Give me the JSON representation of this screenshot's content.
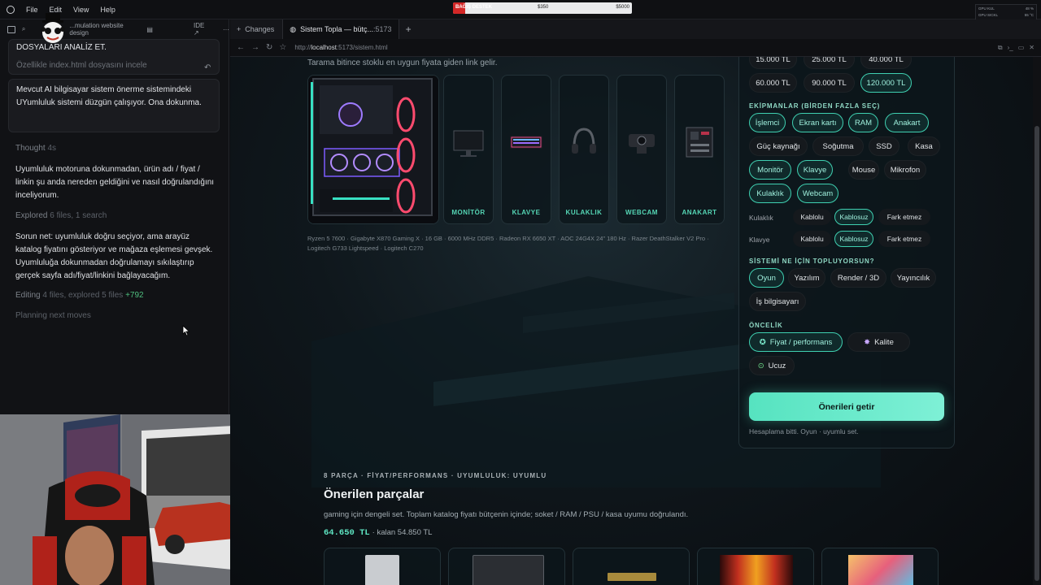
{
  "menubar": {
    "items": [
      "File",
      "Edit",
      "View",
      "Help"
    ]
  },
  "donation": {
    "label": "BAĞIŞ DESTEK",
    "current": "$350",
    "goal": "$5000",
    "progress": 0.07
  },
  "hwmon": {
    "rows": [
      {
        "label": "GPU KUL",
        "value": "48 %"
      },
      {
        "label": "GPU SICKL",
        "value": "55 °C"
      },
      {
        "label": "CPU KUL",
        "value": "28 %"
      },
      {
        "label": "CPU TEMP",
        "value": "74.5 °C"
      }
    ]
  },
  "left_panel": {
    "title": "...mulation website design",
    "ide_label": "IDE ↗",
    "prev_msg_line1": "DOSYALARI ANALİZ ET.",
    "prev_msg_line2": "Özellikle index.html dosyasını incele",
    "user_msg": "Mevcut AI bilgisayar sistem önerme sistemindeki UYumluluk sistemi düzgün çalışıyor. Ona dokunma.",
    "thought_label": "Thought",
    "thought_time": "4s",
    "para1": "Uyumluluk motoruna dokunmadan, ürün adı / fiyat / linkin şu anda nereden geldiğini ve nasıl doğrulandığını inceliyorum.",
    "explored_label": "Explored",
    "explored_detail": "6 files, 1 search",
    "para2": "Sorun net: uyumluluk doğru seçiyor, ama arayüz katalog fiyatını gösteriyor ve mağaza eşlemesi gevşek. Uyumluluğa dokunmadan doğrulamayı sıkılaştırıp gerçek sayfa adı/fiyat/linkini bağlayacağım.",
    "editing_label": "Editing",
    "editing_detail": "4 files, explored 5 files",
    "editing_added": "+792",
    "planning": "Planning next moves"
  },
  "browser": {
    "changes_tab": "Changes",
    "active_tab": "Sistem Topla — bütç...",
    "active_tab_port": ":5173",
    "url_prefix": "http://",
    "url_host": "localhost",
    "url_path": ":5173/sistem.html"
  },
  "page": {
    "subtitle": "Tarama bitince stoklu en uygun fiyata giden link gelir.",
    "part_cards": [
      {
        "label": "MONİTÖR",
        "icon": "monitor-icon"
      },
      {
        "label": "KLAVYE",
        "icon": "keyboard-icon"
      },
      {
        "label": "KULAKLIK",
        "icon": "headphones-icon"
      },
      {
        "label": "WEBCAM",
        "icon": "webcam-icon"
      },
      {
        "label": "ANAKART",
        "icon": "motherboard-icon"
      }
    ],
    "specs": "Ryzen 5 7600 · Gigabyte X870 Gaming X · 16 GB · 6000 MHz DDR5 · Radeon RX 6650 XT · AOC 24G4X 24\" 180 Hz · Razer DeathStalker V2 Pro · Logitech G733 Lightspeed · Logitech C270",
    "budget_row1": [
      "15.000 TL",
      "25.000 TL",
      "40.000 TL"
    ],
    "budget_row2": [
      "60.000 TL",
      "90.000 TL",
      "120.000 TL"
    ],
    "equipment_title": "EKİPMANLAR (BİRDEN FAZLA SEÇ)",
    "equip_row1": [
      "İşlemci",
      "Ekran kartı",
      "RAM",
      "Anakart"
    ],
    "equip_row2": [
      "Güç kaynağı",
      "Soğutma",
      "SSD",
      "Kasa"
    ],
    "equip_row3": [
      "Monitör",
      "Klavye",
      "Mouse",
      "Mikrofon"
    ],
    "equip_row4": [
      "Kulaklık",
      "Webcam"
    ],
    "headset_label": "Kulaklık",
    "keyboard_label": "Klavye",
    "conn_options": [
      "Kablolu",
      "Kablosuz",
      "Fark etmez"
    ],
    "purpose_title": "SİSTEMİ NE İÇİN TOPLUYORSUN?",
    "purpose_row1": [
      "Oyun",
      "Yazılım",
      "Render / 3D",
      "Yayıncılık"
    ],
    "purpose_row2": [
      "İş bilgisayarı"
    ],
    "priority_title": "ÖNCELİK",
    "priority_options": [
      "Fiyat / performans",
      "Kalite",
      "Ucuz"
    ],
    "submit_label": "Önerileri getir",
    "status_text": "Hesaplama bitti. Oyun · uyumlu set.",
    "result_meta": "8 PARÇA · FİYAT/PERFORMANS · UYUMLULUK: UYUMLU",
    "result_title": "Önerilen parçalar",
    "result_desc": "gaming için dengeli set. Toplam katalog fiyatı bütçenin içinde; soket / RAM / PSU / kasa uyumu doğrulandı.",
    "total_price": "64.650 TL",
    "remaining": "· kalan 54.850 TL"
  },
  "colors": {
    "accent": "#3fd0b1",
    "accent_text": "#55d6b5",
    "button_bg": "#5ee8c6"
  }
}
